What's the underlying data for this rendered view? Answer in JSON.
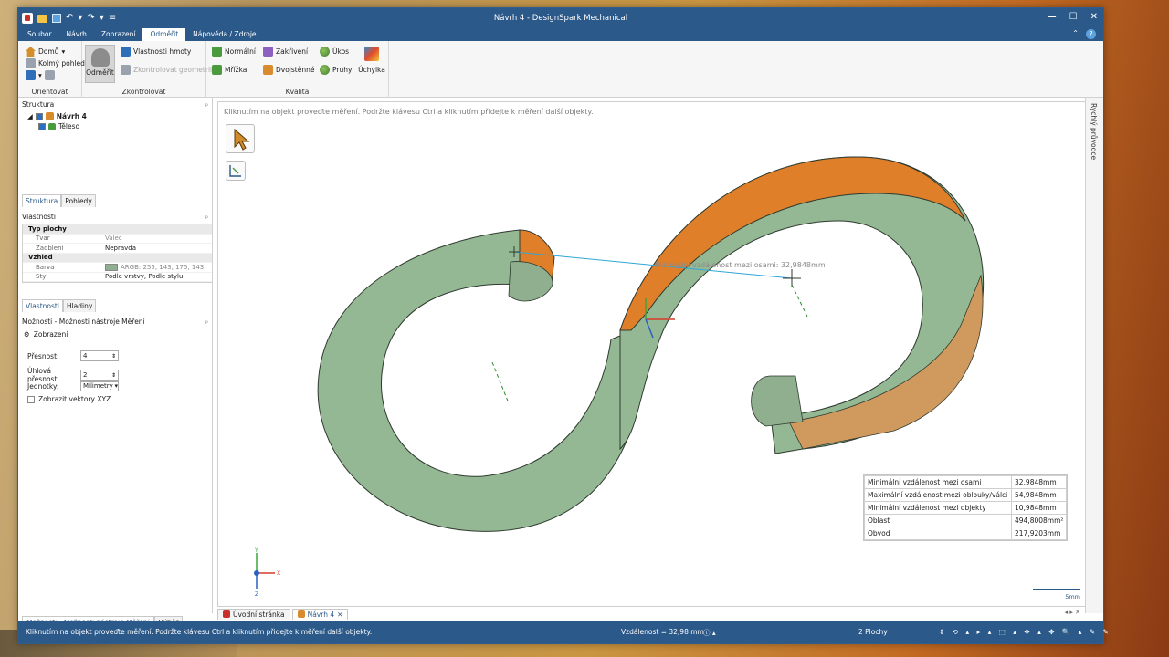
{
  "window": {
    "title": "Návrh 4 - DesignSpark Mechanical"
  },
  "ribbon": {
    "tabs": [
      "Soubor",
      "Návrh",
      "Zobrazení",
      "Odměřit",
      "Nápověda / Zdroje"
    ],
    "orientovat": {
      "domu": "Domů",
      "kolmy": "Kolmý pohled",
      "label": "Orientovat"
    },
    "zkontrolovat": {
      "odmerit": "Odměřit",
      "vlastnosti": "Vlastnosti hmoty",
      "kontrolovat": "Zkontrolovat geometrii",
      "label": "Zkontrolovat"
    },
    "kvalita": {
      "normalni": "Normální",
      "zakriveni": "Zakřivení",
      "ukos": "Úkos",
      "mrizka": "Mřížka",
      "dvojstenne": "Dvojstěnné",
      "pruhy": "Pruhy",
      "uchylka": "Úchylka",
      "label": "Kvalita"
    }
  },
  "structure": {
    "title": "Struktura",
    "root": "Návrh 4",
    "child": "Těleso",
    "tabs": [
      "Struktura",
      "Pohledy"
    ]
  },
  "properties": {
    "title": "Vlastnosti",
    "rows": [
      {
        "group": "Typ plochy"
      },
      {
        "k": "Tvar",
        "v": "Válec",
        "dim": true
      },
      {
        "k": "Zaoblení",
        "v": "Nepravda"
      },
      {
        "group": "Vzhled"
      },
      {
        "k": "Barva",
        "v": "ARGB: 255, 143, 175, 143",
        "dim": true,
        "swatch": true
      },
      {
        "k": "Styl",
        "v": "Podle vrstvy, Podle stylu"
      }
    ],
    "tabs": [
      "Vlastnosti",
      "Hladiny"
    ]
  },
  "options": {
    "title": "Možnosti - Možnosti nástroje Měření",
    "display": "Zobrazení",
    "precision_label": "Přesnost:",
    "precision": "4",
    "angle_label": "Úhlová přesnost:",
    "angle": "2",
    "units_label": "Jednotky:",
    "units": "Milimetry",
    "xyz_label": "Zobrazit vektory XYZ"
  },
  "left_bottom_tabs": [
    "Možnosti - Možnosti nástroje Měření",
    "Výběr"
  ],
  "viewport": {
    "hint": "Kliknutím na objekt proveďte měření.  Podržte klávesu Ctrl a kliknutím přidejte k měření další objekty.",
    "measure_label": "Minimální vzdálenost mezi osami: 32,9848mm",
    "results": [
      {
        "k": "Minimální vzdálenost mezi osami",
        "v": "32,9848mm"
      },
      {
        "k": "Maximální vzdálenost mezi oblouky/válci",
        "v": "54,9848mm"
      },
      {
        "k": "Minimální vzdálenost mezi objekty",
        "v": "10,9848mm"
      },
      {
        "k": "Oblast",
        "v": "494,8008mm²"
      },
      {
        "k": "Obvod",
        "v": "217,9203mm"
      }
    ],
    "scale": "5mm",
    "shape_green": "#8faf8f",
    "shape_orange": "#e07f2a"
  },
  "doc_tabs": [
    "Úvodní stránka",
    "Návrh 4"
  ],
  "right_strip": "Rychlý průvodce",
  "status": {
    "message": "Kliknutím na objekt proveďte měření.  Podržte klávesu Ctrl a kliknutím přidejte k měření další objekty.",
    "distance": "Vzdálenost = 32,98 mm",
    "faces": "2 Plochy"
  }
}
